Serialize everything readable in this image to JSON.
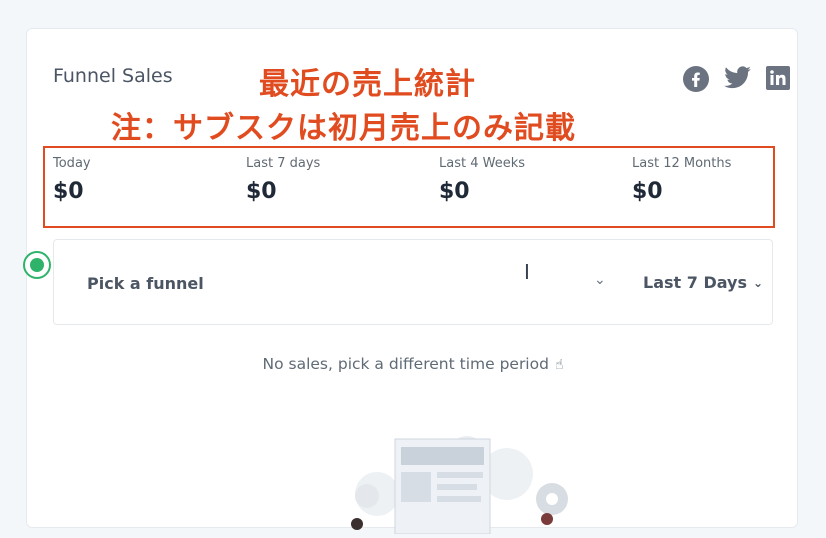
{
  "card": {
    "title": "Funnel Sales",
    "overlay": {
      "line1": "最近の売上統計",
      "line2": "注：サブスクは初月売上のみ記載",
      "color": "#e04b1f"
    },
    "social_icons": [
      "facebook-icon",
      "twitter-icon",
      "linkedin-icon"
    ],
    "stats": [
      {
        "label": "Today",
        "value": "$0"
      },
      {
        "label": "Last 7 days",
        "value": "$0"
      },
      {
        "label": "Last 4 Weeks",
        "value": "$0"
      },
      {
        "label": "Last 12 Months",
        "value": "$0"
      }
    ],
    "filter": {
      "funnel_label": "Pick a funnel",
      "period_label": "Last 7 Days"
    },
    "empty_message": "No sales, pick a different time period",
    "colors": {
      "accent_green": "#2fb36a",
      "icon_gray": "#6b7280"
    }
  }
}
